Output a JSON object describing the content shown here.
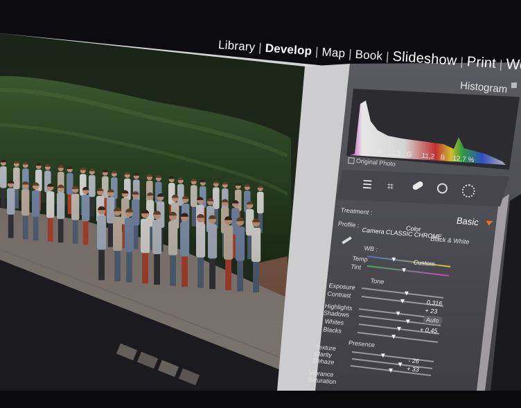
{
  "module_picker": {
    "items": [
      {
        "label": "Library"
      },
      {
        "label": "Develop"
      },
      {
        "label": "Map"
      },
      {
        "label": "Book"
      },
      {
        "label": "Slideshow"
      },
      {
        "label": "Print"
      },
      {
        "label": "Web"
      }
    ],
    "separator": "|"
  },
  "histogram": {
    "title": "Histogram",
    "r_label": "R",
    "r_value": "11,2",
    "g_label": "G",
    "g_value": "11,2",
    "b_label": "B",
    "b_value": "12,7 %",
    "original_photo_label": "Original Photo"
  },
  "tools": {
    "icons": [
      "sliders-icon",
      "crop-icon",
      "healing-icon",
      "redeye-icon",
      "masking-icon"
    ]
  },
  "basic_panel": {
    "panel_title": "Basic",
    "treatment_label": "Treatment :",
    "color_label": "Color",
    "bw_label": "Black & White",
    "profile_label": "Profile :",
    "profile_value": "Camera CLASSIC CHROME",
    "wb_label": "WB :",
    "wb_value": "Custom",
    "temp_label": "Temp",
    "tint_label": "Tint",
    "tone_label": "Tone",
    "auto_label": "Auto",
    "exposure_label": "Exposure",
    "exposure_value": "0,316",
    "contrast_label": "Contrast",
    "contrast_value": "+ 23",
    "highlights_label": "Highlights",
    "shadows_label": "Shadows",
    "shadows_value": "+ 0,45",
    "whites_label": "Whites",
    "blacks_label": "Blacks",
    "presence_label": "Presence",
    "texture_label": "Texture",
    "texture_value": "- 26",
    "clarity_label": "Clarity",
    "clarity_value": "+ 33",
    "dehaze_label": "Dehaze",
    "vibrance_label": "Vibrance",
    "saturation_label": "Saturation"
  },
  "colors": {
    "screen_black": "#0a0a0c",
    "hedge_green": "#2f4a26",
    "panel_gray": "#4f4f55",
    "panel_dark": "#38383d",
    "accent_orange": "#e8702a",
    "paving": "#9a8f87"
  }
}
